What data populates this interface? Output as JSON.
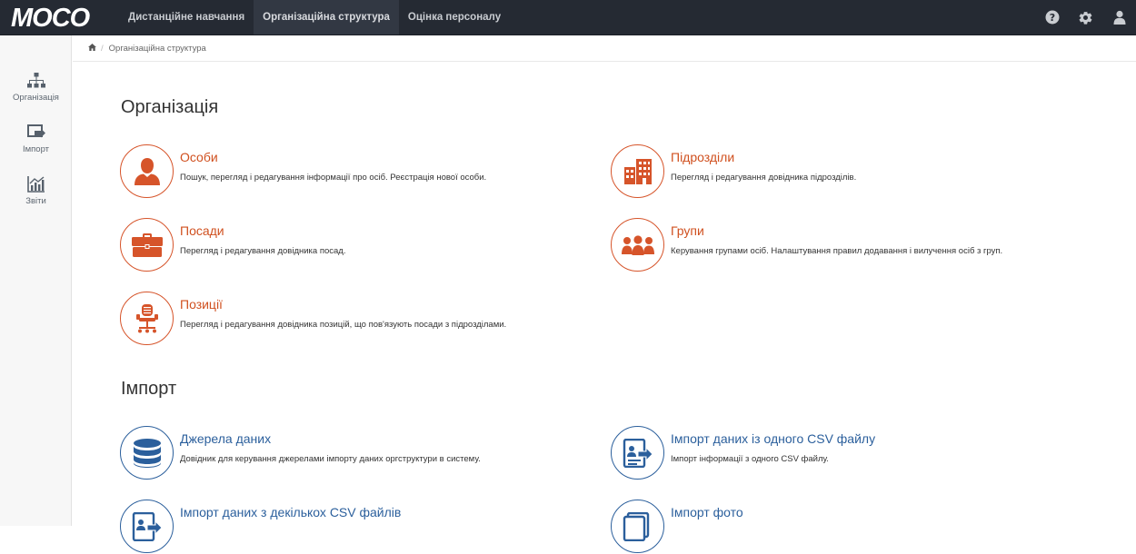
{
  "app": {
    "logo_text": "MOCO"
  },
  "nav": [
    {
      "label": "Дистанційне навчання"
    },
    {
      "label": "Організаційна структура"
    },
    {
      "label": "Оцінка персоналу"
    }
  ],
  "top_icons": [
    "help-icon",
    "gear-icon",
    "user-icon"
  ],
  "sidebar": {
    "items": [
      {
        "label": "Організація",
        "icon": "org-chart-icon"
      },
      {
        "label": "Імпорт",
        "icon": "import-icon"
      },
      {
        "label": "Звіти",
        "icon": "reports-icon"
      }
    ]
  },
  "breadcrumb": {
    "home_icon": "home-icon",
    "current": "Організаційна структура"
  },
  "sections": {
    "organization": {
      "title": "Організація",
      "cards": [
        {
          "title": "Особи",
          "desc": "Пошук, перегляд і редагування інформації про осіб. Реєстрація нової особи.",
          "icon": "person-icon"
        },
        {
          "title": "Підрозділи",
          "desc": "Перегляд і редагування довідника підрозділів.",
          "icon": "building-icon"
        },
        {
          "title": "Посади",
          "desc": "Перегляд і редагування довідника посад.",
          "icon": "briefcase-icon"
        },
        {
          "title": "Групи",
          "desc": "Керування групами осіб. Налаштування правил додавання і вилучення осіб з груп.",
          "icon": "group-icon"
        },
        {
          "title": "Позиції",
          "desc": "Перегляд і редагування довідника позицій, що пов'язують посади з підрозділами.",
          "icon": "chair-icon"
        }
      ]
    },
    "import": {
      "title": "Імпорт",
      "cards": [
        {
          "title": "Джерела даних",
          "desc": "Довідник для керування джерелами імпорту даних оргструктури в систему.",
          "icon": "database-icon"
        },
        {
          "title": "Імпорт даних із одного CSV файлу",
          "desc": "Імпорт інформації з одного CSV файлу.",
          "icon": "csv-import-icon"
        },
        {
          "title": "Імпорт даних з декількох CSV файлів",
          "desc": "",
          "icon": "multi-csv-import-icon"
        },
        {
          "title": "Імпорт фото",
          "desc": "",
          "icon": "photo-import-icon"
        }
      ]
    }
  },
  "colors": {
    "topbar": "#252a33",
    "accent_orange": "#d6542a",
    "accent_blue": "#2b5f9c"
  }
}
